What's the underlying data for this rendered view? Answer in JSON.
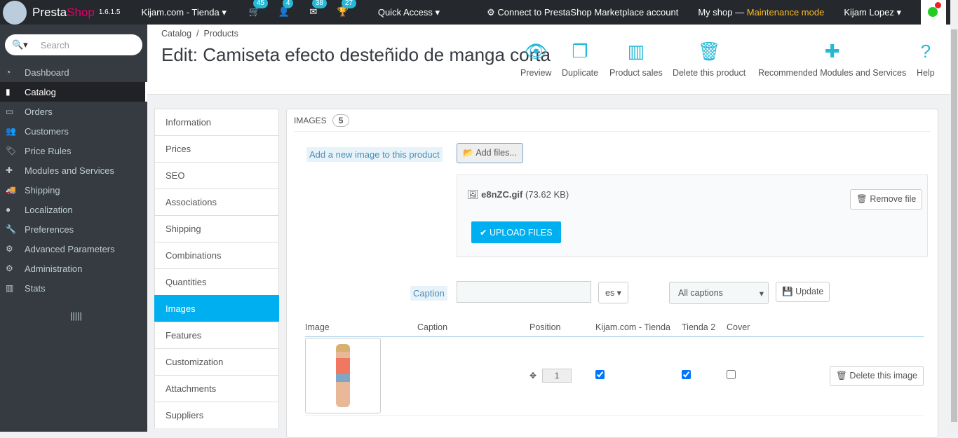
{
  "topbar": {
    "brand_a": "Presta",
    "brand_b": "Shop",
    "version": "1.6.1.5",
    "shop": "Kijam.com - Tienda",
    "notifications": [
      {
        "icon": "cart-icon",
        "count": "45"
      },
      {
        "icon": "user-icon",
        "count": "4"
      },
      {
        "icon": "envelope-icon",
        "count": "38"
      },
      {
        "icon": "trophy-icon",
        "count": "27"
      }
    ],
    "quick_access": "Quick Access",
    "connect": "Connect to PrestaShop Marketplace account",
    "myshop": "My shop",
    "dash": "—",
    "maintenance": "Maintenance mode",
    "user": "Kijam Lopez",
    "accent": "#25b9d7"
  },
  "sidebar": {
    "search_placeholder": "Search",
    "items": [
      {
        "label": "Dashboard",
        "icon": "dashboard-icon"
      },
      {
        "label": "Catalog",
        "icon": "book-icon"
      },
      {
        "label": "Orders",
        "icon": "credit-card-icon"
      },
      {
        "label": "Customers",
        "icon": "users-icon"
      },
      {
        "label": "Price Rules",
        "icon": "tags-icon"
      },
      {
        "label": "Modules and Services",
        "icon": "puzzle-icon"
      },
      {
        "label": "Shipping",
        "icon": "truck-icon"
      },
      {
        "label": "Localization",
        "icon": "globe-icon"
      },
      {
        "label": "Preferences",
        "icon": "wrench-icon"
      },
      {
        "label": "Advanced Parameters",
        "icon": "cogs-icon"
      },
      {
        "label": "Administration",
        "icon": "cog-icon"
      },
      {
        "label": "Stats",
        "icon": "bar-chart-icon"
      }
    ]
  },
  "header": {
    "breadcrumb": [
      "Catalog",
      "Products"
    ],
    "sep": "/",
    "title": "Edit: Camiseta efecto desteñido de manga corta",
    "toolbar": [
      "Preview",
      "Duplicate",
      "Product sales",
      "Delete this product",
      "Recommended Modules and Services",
      "Help"
    ]
  },
  "tabs": [
    "Information",
    "Prices",
    "SEO",
    "Associations",
    "Shipping",
    "Combinations",
    "Quantities",
    "Images",
    "Features",
    "Customization",
    "Attachments",
    "Suppliers"
  ],
  "images": {
    "heading": "IMAGES",
    "count": "5",
    "add_label": "Add a new image to this product",
    "add_files": "Add files...",
    "file_name": "e8nZC.gif",
    "file_size": "(73.62 KB)",
    "remove_file": "Remove file",
    "upload": "UPLOAD FILES",
    "caption_label": "Caption",
    "caption_value": "",
    "lang": "es",
    "captions_select": "All captions",
    "update": "Update",
    "columns": [
      "Image",
      "Caption",
      "Position",
      "Kijam.com - Tienda",
      "Tienda 2",
      "Cover"
    ],
    "rows": [
      {
        "caption": "",
        "position": "1",
        "shop1": true,
        "shop2": true,
        "cover": false,
        "delete": "Delete this image"
      }
    ]
  }
}
